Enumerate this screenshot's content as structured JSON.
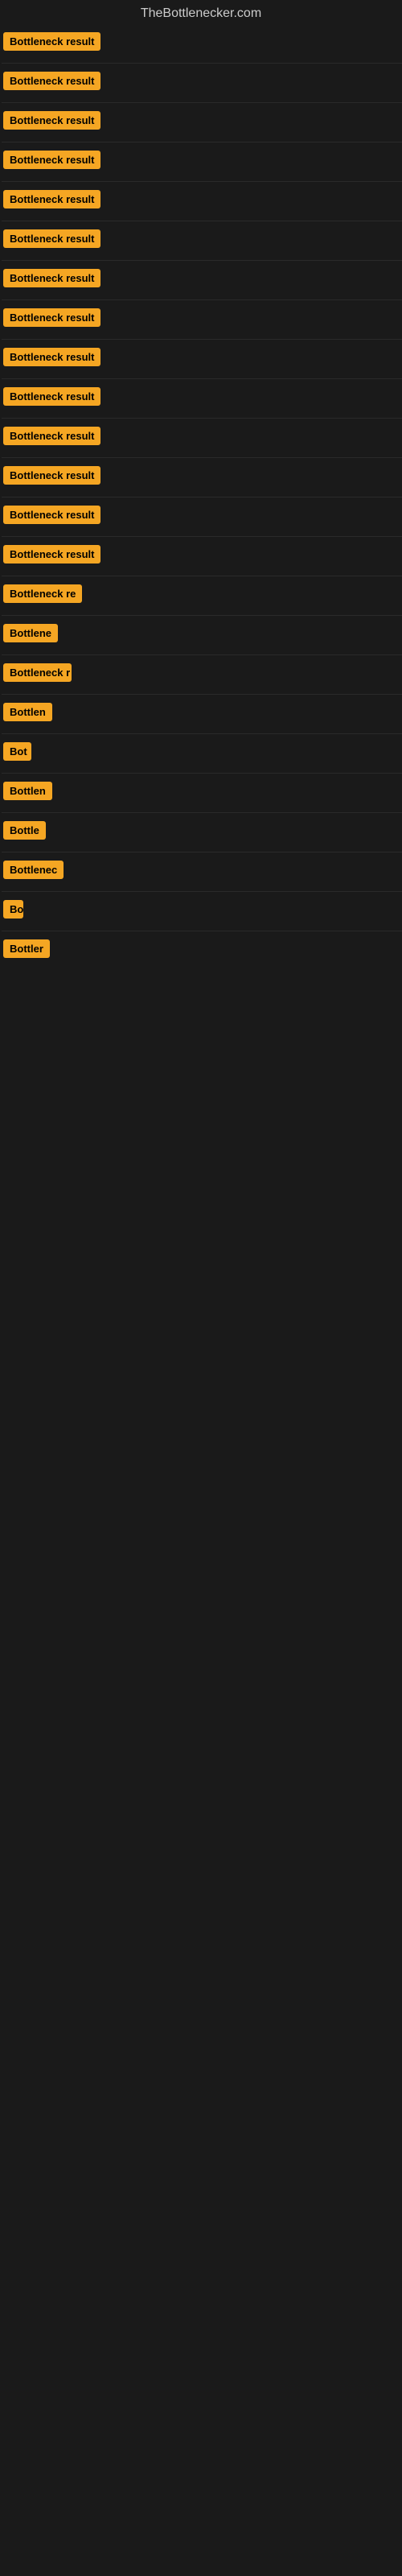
{
  "site": {
    "title": "TheBottlenecker.com"
  },
  "bars": [
    {
      "label": "Bottleneck result",
      "width": 130
    },
    {
      "label": "Bottleneck result",
      "width": 130
    },
    {
      "label": "Bottleneck result",
      "width": 130
    },
    {
      "label": "Bottleneck result",
      "width": 130
    },
    {
      "label": "Bottleneck result",
      "width": 130
    },
    {
      "label": "Bottleneck result",
      "width": 130
    },
    {
      "label": "Bottleneck result",
      "width": 130
    },
    {
      "label": "Bottleneck result",
      "width": 130
    },
    {
      "label": "Bottleneck result",
      "width": 130
    },
    {
      "label": "Bottleneck result",
      "width": 130
    },
    {
      "label": "Bottleneck result",
      "width": 130
    },
    {
      "label": "Bottleneck result",
      "width": 130
    },
    {
      "label": "Bottleneck result",
      "width": 130
    },
    {
      "label": "Bottleneck result",
      "width": 130
    },
    {
      "label": "Bottleneck re",
      "width": 100
    },
    {
      "label": "Bottlene",
      "width": 75
    },
    {
      "label": "Bottleneck r",
      "width": 85
    },
    {
      "label": "Bottlen",
      "width": 65
    },
    {
      "label": "Bot",
      "width": 35
    },
    {
      "label": "Bottlen",
      "width": 65
    },
    {
      "label": "Bottle",
      "width": 55
    },
    {
      "label": "Bottlenec",
      "width": 80
    },
    {
      "label": "Bo",
      "width": 25
    },
    {
      "label": "Bottler",
      "width": 58
    }
  ],
  "colors": {
    "bar_bg": "#f5a623",
    "bar_text": "#000000",
    "site_title": "#cccccc",
    "page_bg": "#1a1a1a"
  }
}
